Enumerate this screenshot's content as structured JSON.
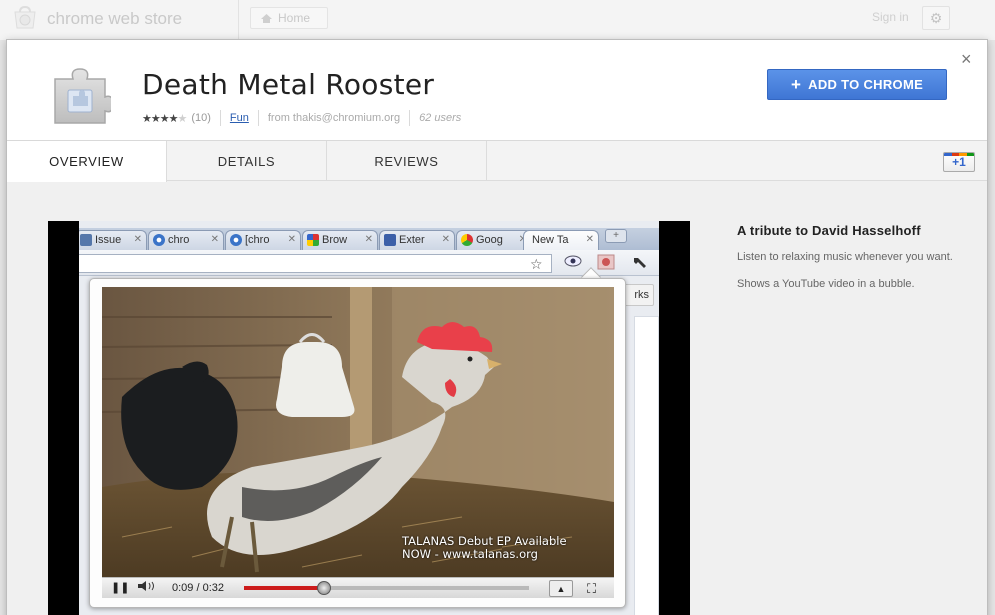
{
  "store": {
    "title": "chrome web store",
    "home_label": "Home",
    "sign_in": "Sign in",
    "settings_glyph": "⚙"
  },
  "extension": {
    "name": "Death Metal Rooster",
    "rating_count": "(10)",
    "rating": 4,
    "rating_max": 5,
    "category": "Fun",
    "author": "from  thakis@chromium.org",
    "users": "62 users",
    "add_button": "ADD TO CHROME",
    "close_glyph": "×"
  },
  "tabs": [
    {
      "label": "OVERVIEW",
      "active": true
    },
    {
      "label": "DETAILS",
      "active": false
    },
    {
      "label": "REVIEWS",
      "active": false
    }
  ],
  "plus_one": "+1",
  "screenshot": {
    "browser_tabs": [
      {
        "label": "Issue",
        "icon": "issue-icon"
      },
      {
        "label": "chro",
        "icon": "chromium-icon"
      },
      {
        "label": "[chro",
        "icon": "chromium-icon"
      },
      {
        "label": "Brow",
        "icon": "browser-icon"
      },
      {
        "label": "Exter",
        "icon": "puzzle-icon"
      },
      {
        "label": "Goog",
        "icon": "chrome-icon"
      },
      {
        "label": "New Ta",
        "icon": "none"
      }
    ],
    "new_tab_glyph": "+",
    "partial_button": "rks",
    "video_caption_line1": "TALANAS Debut EP Available",
    "video_caption_line2": "NOW - www.talanas.org",
    "time": "0:09 / 0:32",
    "progress": 0.28,
    "buffered": 1.0
  },
  "description": {
    "title": "A tribute to David Hasselhoff",
    "p1": "Listen to relaxing music whenever you want.",
    "p2": "Shows a YouTube video in a bubble."
  },
  "colors": {
    "accent": "#4a86e8",
    "link": "#2a5db0",
    "seek_red": "#cc1b1b"
  }
}
